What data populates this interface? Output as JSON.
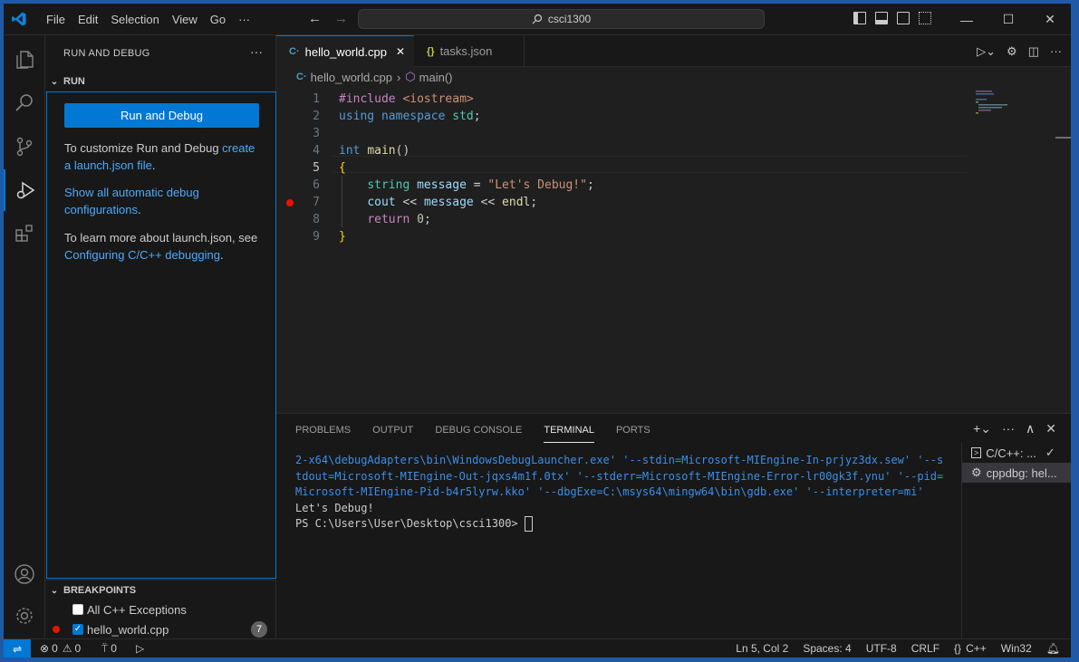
{
  "window": {
    "title": "csci1300"
  },
  "menu": [
    "File",
    "Edit",
    "Selection",
    "View",
    "Go",
    "···"
  ],
  "sidebar": {
    "title": "RUN AND DEBUG",
    "more": "···",
    "run_section": "RUN",
    "run_button": "Run and Debug",
    "p1_text": "To customize Run and Debug ",
    "p1_link": "create a launch.json file",
    "p1_end": ".",
    "p2_link": "Show all automatic debug configurations",
    "p2_end": ".",
    "p3_text": "To learn more about launch.json, see ",
    "p3_link": "Configuring C/C++ debugging",
    "p3_end": ".",
    "breakpoints_section": "BREAKPOINTS",
    "bp_all": "All C++ Exceptions",
    "bp_file": "hello_world.cpp",
    "bp_count": "7"
  },
  "tabs": [
    {
      "label": "hello_world.cpp",
      "icon": "cpp-icon",
      "close": "✕"
    },
    {
      "label": "tasks.json",
      "icon": "json-icon"
    }
  ],
  "breadcrumb": {
    "file": "hello_world.cpp",
    "sep": "›",
    "symbol": "main()"
  },
  "code": {
    "lines": [
      "1",
      "2",
      "3",
      "4",
      "5",
      "6",
      "7",
      "8",
      "9"
    ],
    "l1a": "#include ",
    "l1b": "<iostream>",
    "l2a": "using ",
    "l2b": "namespace ",
    "l2c": "std",
    "l2d": ";",
    "l4a": "int ",
    "l4b": "main",
    "l4c": "()",
    "l5": "{",
    "l6a": "    ",
    "l6b": "string ",
    "l6c": "message",
    "l6d": " = ",
    "l6e": "\"Let's Debug!\"",
    "l6f": ";",
    "l7a": "    ",
    "l7b": "cout",
    "l7c": " << ",
    "l7d": "message",
    "l7e": " << ",
    "l7f": "endl",
    "l7g": ";",
    "l8a": "    ",
    "l8b": "return ",
    "l8c": "0",
    "l8d": ";",
    "l9": "}"
  },
  "panel": {
    "tabs": [
      "PROBLEMS",
      "OUTPUT",
      "DEBUG CONSOLE",
      "TERMINAL",
      "PORTS"
    ],
    "terminal_cmd": "2-x64\\debugAdapters\\bin\\WindowsDebugLauncher.exe' '--stdin=Microsoft-MIEngine-In-prjyz3dx.sew' '--stdout=Microsoft-MIEngine-Out-jqxs4m1f.0tx' '--stderr=Microsoft-MIEngine-Error-lr00gk3f.ynu' '--pid=Microsoft-MIEngine-Pid-b4r5lyrw.kko' '--dbgExe=C:\\msys64\\mingw64\\bin\\gdb.exe' '--interpreter=mi'",
    "terminal_out": "Let's Debug!",
    "terminal_prompt": "PS C:\\Users\\User\\Desktop\\csci1300> ",
    "terminals": [
      "C/C++: ...",
      "cppdbg: hel..."
    ]
  },
  "status": {
    "errors": "0",
    "warnings": "0",
    "ports": "0",
    "position": "Ln 5, Col 2",
    "spaces": "Spaces: 4",
    "encoding": "UTF-8",
    "eol": "CRLF",
    "language": "C++",
    "platform": "Win32"
  },
  "colors": {
    "accent": "#0078d4",
    "breakpoint": "#e51400",
    "link": "#4daafc"
  }
}
